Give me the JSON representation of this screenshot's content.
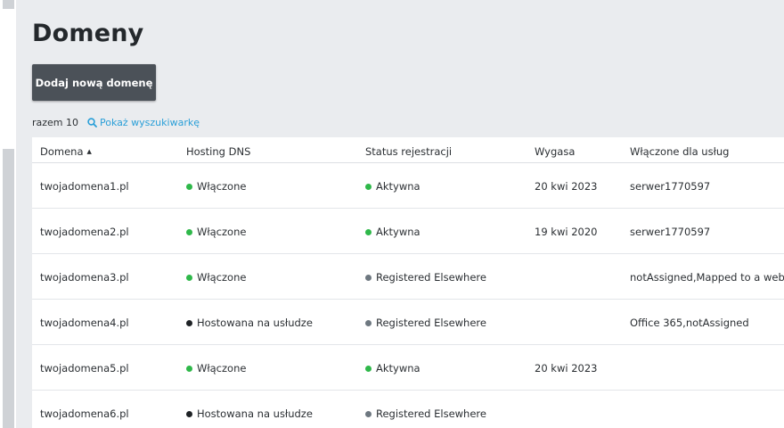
{
  "page": {
    "title": "Domeny",
    "add_button_label": "Dodaj nową domenę",
    "summary_label": "razem 10",
    "search_link_label": "Pokaż wyszukiwarkę"
  },
  "colors": {
    "green": "#2fb84a",
    "dark": "#1f2326",
    "gray": "#6e7880",
    "link": "#2a9fd8",
    "button": "#4b5158"
  },
  "table": {
    "headers": {
      "domain": "Domena",
      "hosting": "Hosting DNS",
      "status": "Status rejestracji",
      "expires": "Wygasa",
      "services": "Włączone dla usług"
    },
    "rows": [
      {
        "domain": "twojadomena1.pl",
        "hosting": "Włączone",
        "hosting_color": "#2fb84a",
        "status": "Aktywna",
        "status_color": "#2fb84a",
        "expires": "20 kwi 2023",
        "services": "serwer1770597"
      },
      {
        "domain": "twojadomena2.pl",
        "hosting": "Włączone",
        "hosting_color": "#2fb84a",
        "status": "Aktywna",
        "status_color": "#2fb84a",
        "expires": "19 kwi 2020",
        "services": "serwer1770597"
      },
      {
        "domain": "twojadomena3.pl",
        "hosting": "Włączone",
        "hosting_color": "#2fb84a",
        "status": "Registered Elsewhere",
        "status_color": "#6e7880",
        "expires": "",
        "services": "notAssigned,Mapped to a website"
      },
      {
        "domain": "twojadomena4.pl",
        "hosting": "Hostowana na usłudze",
        "hosting_color": "#1f2326",
        "status": "Registered Elsewhere",
        "status_color": "#6e7880",
        "expires": "",
        "services": "Office 365,notAssigned"
      },
      {
        "domain": "twojadomena5.pl",
        "hosting": "Włączone",
        "hosting_color": "#2fb84a",
        "status": "Aktywna",
        "status_color": "#2fb84a",
        "expires": "20 kwi 2023",
        "services": ""
      },
      {
        "domain": "twojadomena6.pl",
        "hosting": "Hostowana na usłudze",
        "hosting_color": "#1f2326",
        "status": "Registered Elsewhere",
        "status_color": "#6e7880",
        "expires": "",
        "services": ""
      }
    ]
  }
}
